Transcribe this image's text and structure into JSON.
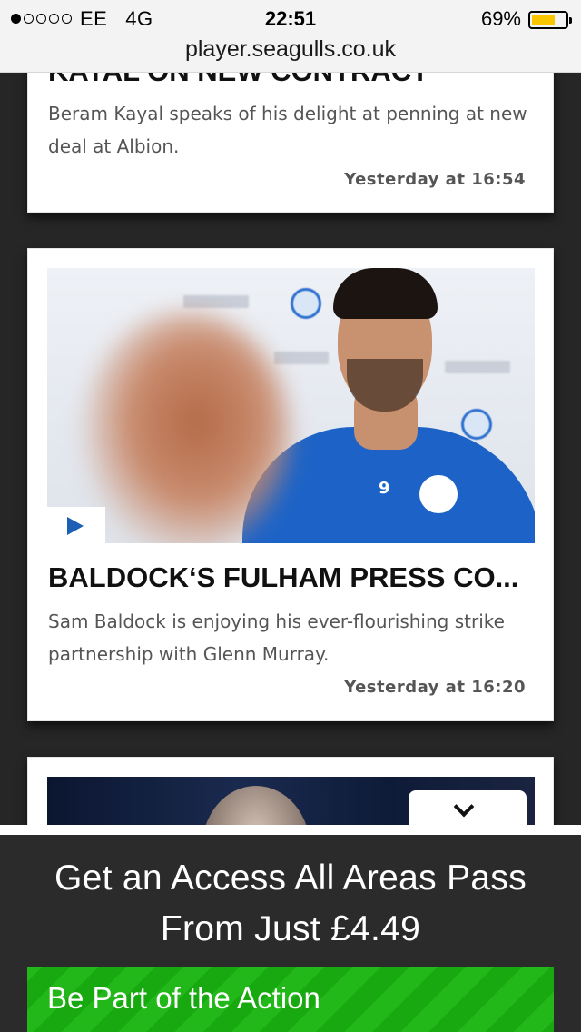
{
  "status_bar": {
    "signal_dots": [
      true,
      false,
      false,
      false,
      false
    ],
    "carrier": "EE",
    "network": "4G",
    "time": "22:51",
    "battery_percent_text": "69%",
    "battery_level": 0.69,
    "url": "player.seagulls.co.uk"
  },
  "articles": [
    {
      "title": "KAYAL ON NEW CONTRACT",
      "description": "Beram Kayal speaks of his delight at penning at new deal at Albion.",
      "timestamp": "Yesterday at 16:54"
    },
    {
      "title": "BALDOCK‘S FULHAM PRESS CO...",
      "description": "Sam Baldock is enjoying his ever-flourishing strike partnership with Glenn Murray.",
      "timestamp": "Yesterday at 16:20",
      "shirt_number": "9",
      "has_video": true
    },
    {
      "title": "",
      "description": "",
      "timestamp": ""
    }
  ],
  "promo": {
    "headline_line1": "Get an Access All Areas Pass",
    "headline_line2": "From Just £4.49",
    "cta_label": "Be Part of the Action"
  },
  "icons": {
    "play": "play-icon",
    "chevron": "chevron-down-icon"
  },
  "colors": {
    "brand_blue": "#1d63c7",
    "cta_green": "#18a80f",
    "battery": "#f7c600",
    "background": "#262626"
  }
}
